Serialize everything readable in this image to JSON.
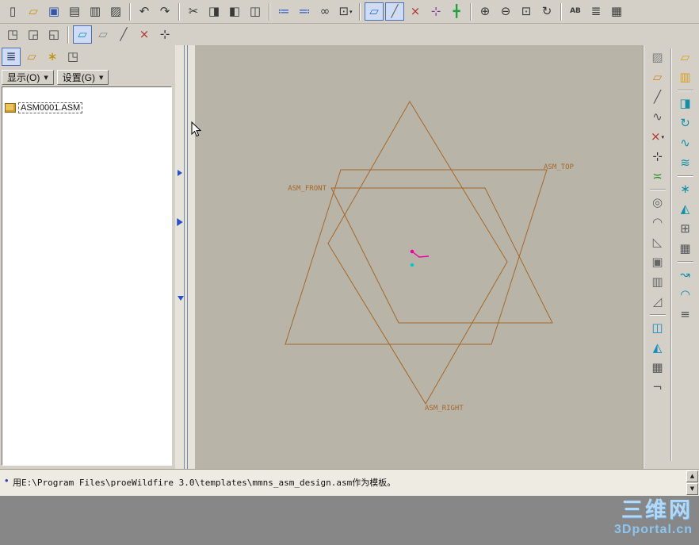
{
  "icons": {
    "dropdown_mini": "▾",
    "dropdown_solid": "▼",
    "up_arrow": "▲",
    "down_arrow": "▼"
  },
  "toolbar_top": {
    "items": [
      {
        "name": "new-file-button",
        "icon": "new-file-icon",
        "glyph": "▯"
      },
      {
        "name": "open-file-button",
        "icon": "open-folder-icon",
        "glyph": "▱",
        "color": "#c89020"
      },
      {
        "name": "save-button",
        "icon": "floppy-icon",
        "glyph": "▣",
        "color": "#3355aa"
      },
      {
        "name": "print-button",
        "icon": "printer-icon",
        "glyph": "▤"
      },
      {
        "name": "print-preview-button",
        "icon": "printer-preview-icon",
        "glyph": "▥"
      },
      {
        "name": "send-model-button",
        "icon": "send-icon",
        "glyph": "▨"
      },
      {
        "sep": true
      },
      {
        "name": "undo-button",
        "icon": "undo-icon",
        "glyph": "↶"
      },
      {
        "name": "redo-button",
        "icon": "redo-icon",
        "glyph": "↷"
      },
      {
        "sep": true
      },
      {
        "name": "cut-button",
        "icon": "scissors-icon",
        "glyph": "✂"
      },
      {
        "name": "copy-button",
        "icon": "copy-icon",
        "glyph": "◨"
      },
      {
        "name": "paste-button",
        "icon": "paste-icon",
        "glyph": "◧"
      },
      {
        "name": "paste-special-button",
        "icon": "paste-special-icon",
        "glyph": "◫"
      },
      {
        "sep": true
      },
      {
        "name": "regenerate-button",
        "icon": "regenerate-icon",
        "glyph": "≔",
        "color": "#3060c0"
      },
      {
        "name": "model-player-button",
        "icon": "model-player-icon",
        "glyph": "≕",
        "color": "#3060c0"
      },
      {
        "name": "search-button",
        "icon": "binoculars-icon",
        "glyph": "∞"
      },
      {
        "name": "selection-filter-button",
        "icon": "selection-box-icon",
        "glyph": "⊡",
        "dropdown": true
      },
      {
        "sep": true
      },
      {
        "name": "datum-plane-display-toggle",
        "icon": "datum-plane-icon",
        "glyph": "▱",
        "color": "#2f6fc4",
        "pressed": true
      },
      {
        "name": "datum-axis-display-toggle",
        "icon": "datum-axis-icon",
        "glyph": "╱",
        "color": "#666666",
        "pressed": true
      },
      {
        "name": "datum-point-display-toggle",
        "icon": "datum-point-icon",
        "glyph": "×",
        "color": "#b03030"
      },
      {
        "name": "csys-display-toggle",
        "icon": "csys-icon",
        "glyph": "⊹",
        "color": "#8833aa"
      },
      {
        "name": "spin-center-toggle",
        "icon": "spin-center-icon",
        "glyph": "╋",
        "color": "#20a040"
      },
      {
        "sep": true
      },
      {
        "name": "zoom-in-button",
        "icon": "zoom-in-icon",
        "glyph": "⊕"
      },
      {
        "name": "zoom-out-button",
        "icon": "zoom-out-icon",
        "glyph": "⊖"
      },
      {
        "name": "refit-button",
        "icon": "zoom-fit-icon",
        "glyph": "⊡"
      },
      {
        "name": "reorient-button",
        "icon": "reorient-icon",
        "glyph": "↻"
      },
      {
        "sep": true
      },
      {
        "name": "annotation-toggle",
        "icon": "annotation-icon",
        "glyph": "AB"
      },
      {
        "name": "layers-button",
        "icon": "layers-icon",
        "glyph": "≣"
      },
      {
        "name": "view-manager-button",
        "icon": "view-manager-icon",
        "glyph": "▦"
      }
    ]
  },
  "toolbar_second": {
    "items": [
      {
        "name": "window-cascade-button",
        "icon": "window-icon",
        "glyph": "◳"
      },
      {
        "name": "window-tile-button",
        "icon": "window-icon",
        "glyph": "◲"
      },
      {
        "name": "window-activate-button",
        "icon": "window-icon",
        "glyph": "◱"
      },
      {
        "sep": true
      },
      {
        "name": "datum-plane-tool",
        "icon": "datum-plane-icon",
        "glyph": "▱",
        "color": "#1090c0",
        "pressed": true
      },
      {
        "name": "sketch-tool",
        "icon": "sketch-icon",
        "glyph": "▱",
        "color": "#888888"
      },
      {
        "name": "datum-axis-tool",
        "icon": "datum-axis-icon",
        "glyph": "╱",
        "color": "#555555"
      },
      {
        "name": "datum-point-tool",
        "icon": "datum-point-icon",
        "glyph": "×",
        "color": "#b03030"
      },
      {
        "name": "datum-csys-tool",
        "icon": "csys-icon",
        "glyph": "⊹",
        "color": "#333333"
      }
    ]
  },
  "tree_panel": {
    "toolbar": [
      {
        "name": "model-tree-toggle",
        "icon": "model-tree-icon",
        "glyph": "≣",
        "color": "#334466",
        "pressed": true
      },
      {
        "name": "folder-browser-button",
        "icon": "folder-icon",
        "glyph": "▱",
        "color": "#c89020"
      },
      {
        "name": "favorites-button",
        "icon": "star-icon",
        "glyph": "∗",
        "color": "#c09000"
      },
      {
        "name": "connections-button",
        "icon": "window-icon",
        "glyph": "◳",
        "color": "#444444"
      }
    ],
    "show_dropdown": "显示(O)",
    "settings_dropdown": "设置(G)",
    "items": [
      {
        "label": "ASM0001.ASM"
      }
    ]
  },
  "right_toolbar": {
    "col1": [
      {
        "name": "sketch-tool",
        "icon": "sketch-icon",
        "glyph": "▨",
        "color": "#808080"
      },
      {
        "name": "datum-plane-tool",
        "icon": "datum-plane-icon",
        "glyph": "▱",
        "color": "#cc8822"
      },
      {
        "name": "datum-axis-tool",
        "icon": "datum-axis-icon",
        "glyph": "╱",
        "color": "#555555"
      },
      {
        "name": "datum-curve-tool",
        "icon": "datum-curve-icon",
        "glyph": "∿",
        "color": "#555555"
      },
      {
        "name": "datum-point-tool",
        "icon": "datum-point-icon",
        "glyph": "×",
        "color": "#b03030",
        "dropdown": true
      },
      {
        "name": "datum-csys-tool",
        "icon": "csys-icon",
        "glyph": "⊹",
        "color": "#333333"
      },
      {
        "name": "analysis-tool",
        "icon": "analysis-icon",
        "glyph": "≍",
        "color": "#2a8a2a"
      },
      {
        "sep": true
      },
      {
        "name": "hole-tool",
        "icon": "hole-icon",
        "glyph": "◎",
        "color": "#666666"
      },
      {
        "name": "round-tool",
        "icon": "round-icon",
        "glyph": "◠",
        "color": "#666666"
      },
      {
        "name": "chamfer-tool",
        "icon": "chamfer-icon",
        "glyph": "◺",
        "color": "#666666"
      },
      {
        "name": "shell-tool",
        "icon": "shell-icon",
        "glyph": "▣",
        "color": "#666666"
      },
      {
        "name": "rib-tool",
        "icon": "rib-icon",
        "glyph": "▥",
        "color": "#666666"
      },
      {
        "name": "draft-tool",
        "icon": "draft-icon",
        "glyph": "◿",
        "color": "#666666"
      },
      {
        "sep": true
      },
      {
        "name": "mirror-tool",
        "icon": "mirror-icon",
        "glyph": "◫",
        "color": "#1090c0"
      },
      {
        "name": "trim-tool",
        "icon": "trim-icon",
        "glyph": "◭",
        "color": "#1090c0"
      },
      {
        "name": "pattern-tool",
        "icon": "pattern-icon",
        "glyph": "▦",
        "color": "#555555"
      },
      {
        "name": "note-tool",
        "icon": "note-icon",
        "glyph": "¬",
        "color": "#555555"
      }
    ],
    "col2": [
      {
        "name": "assemble-component-button",
        "icon": "assemble-icon",
        "glyph": "▱",
        "color": "#d8a020"
      },
      {
        "name": "create-component-button",
        "icon": "create-component-icon",
        "glyph": "▥",
        "color": "#d8a020"
      },
      {
        "sep": true
      },
      {
        "name": "extrude-tool",
        "icon": "extrude-icon",
        "glyph": "◨",
        "color": "#1090a8"
      },
      {
        "name": "revolve-tool",
        "icon": "revolve-icon",
        "glyph": "↻",
        "color": "#1090a8"
      },
      {
        "name": "sweep-tool",
        "icon": "sweep-icon",
        "glyph": "∿",
        "color": "#1090a8"
      },
      {
        "name": "blend-tool",
        "icon": "blend-icon",
        "glyph": "≋",
        "color": "#1090a8"
      },
      {
        "sep": true
      },
      {
        "name": "style-tool",
        "icon": "style-icon",
        "glyph": "∗",
        "color": "#1090a8"
      },
      {
        "name": "surface-tool",
        "icon": "surface-icon",
        "glyph": "◭",
        "color": "#1090a8"
      },
      {
        "name": "merge-tool",
        "icon": "merge-icon",
        "glyph": "⊞",
        "color": "#555555"
      },
      {
        "name": "pattern-tool-2",
        "icon": "pattern-icon",
        "glyph": "▦",
        "color": "#555555"
      },
      {
        "sep": true
      },
      {
        "name": "flex-tool",
        "icon": "flex-icon",
        "glyph": "↝",
        "color": "#1090a8"
      },
      {
        "name": "wrap-tool",
        "icon": "wrap-icon",
        "glyph": "◠",
        "color": "#1090a8"
      },
      {
        "name": "offset-tool",
        "icon": "offset-icon",
        "glyph": "≡",
        "color": "#555555"
      }
    ]
  },
  "viewport": {
    "background": "#b8b4a8",
    "plane_color": "#a5682a",
    "labels": {
      "front": "ASM_FRONT",
      "top": "ASM_TOP",
      "right": "ASM_RIGHT"
    },
    "csys_colors": {
      "origin": "#ee00aa",
      "axis_point": "#00cccc"
    }
  },
  "status_bar": {
    "bullet": "•",
    "message": "用E:\\Program Files\\proeWildfire 3.0\\templates\\mmns_asm_design.asm作为模板。"
  },
  "watermark": {
    "line1": "三维网",
    "line2": "3Dportal.cn"
  }
}
